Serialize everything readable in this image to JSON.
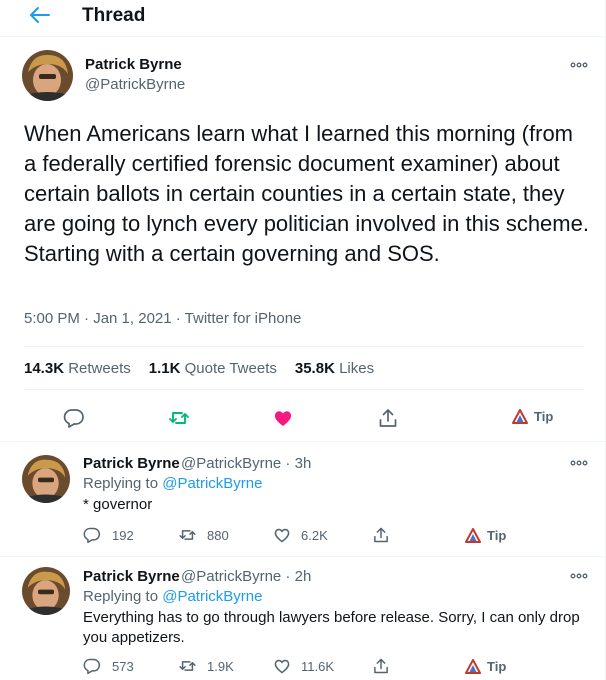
{
  "header": {
    "title": "Thread"
  },
  "main_tweet": {
    "name": "Patrick Byrne",
    "handle": "@PatrickByrne",
    "text": "When Americans learn what I learned this morning (from a federally certified forensic document examiner) about certain ballots in certain counties in a certain state, they are going to lynch every politician involved in this scheme. Starting with a certain governing and SOS.",
    "time": "5:00 PM · Jan 1, 2021",
    "sep": " · ",
    "source": "Twitter for iPhone",
    "stats": {
      "retweets": "14.3K",
      "retweets_label": "Retweets",
      "quotes": "1.1K",
      "quotes_label": "Quote Tweets",
      "likes": "35.8K",
      "likes_label": "Likes"
    },
    "tip_label": "Tip",
    "liked": true
  },
  "replies": [
    {
      "name": "Patrick Byrne",
      "handle": "@PatrickByrne",
      "age": "3h",
      "replying_prefix": "Replying to",
      "replying_to": "@PatrickByrne",
      "text": "* governor",
      "counts": {
        "replies": "192",
        "retweets": "880",
        "likes": "6.2K"
      },
      "tip_label": "Tip"
    },
    {
      "name": "Patrick Byrne",
      "handle": "@PatrickByrne",
      "age": "2h",
      "replying_prefix": "Replying to",
      "replying_to": "@PatrickByrne",
      "text": "Everything has to go through lawyers before release. Sorry, I can only drop you appetizers.",
      "counts": {
        "replies": "573",
        "retweets": "1.9K",
        "likes": "11.6K"
      },
      "tip_label": "Tip"
    }
  ],
  "colors": {
    "accent": "#1d9bf0",
    "like": "#f91880",
    "retweet": "#00ba7c",
    "secondary": "#536471"
  },
  "icons": [
    "back-arrow-icon",
    "more-icon",
    "reply-icon",
    "retweet-icon",
    "heart-icon",
    "share-icon",
    "tip-icon"
  ]
}
